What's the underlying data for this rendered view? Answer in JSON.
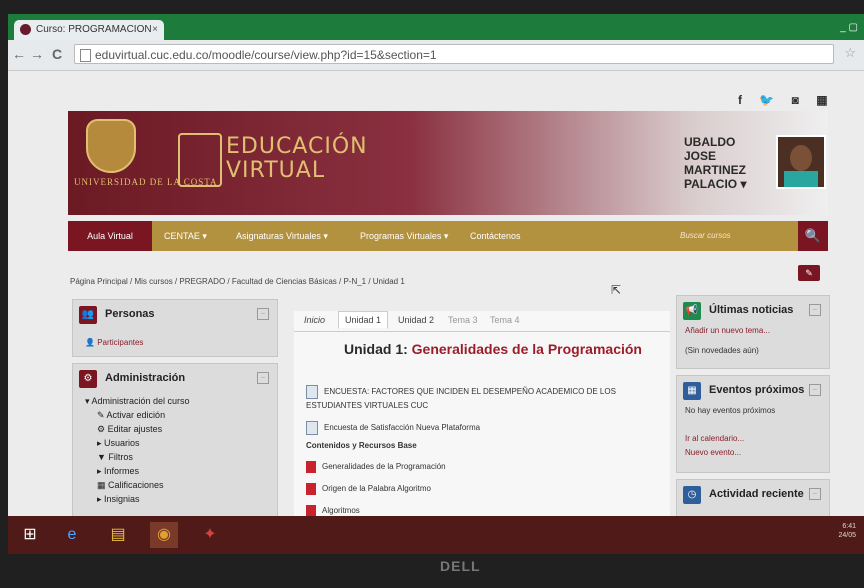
{
  "browser": {
    "tab_title": "Curso: PROGRAMACION",
    "tab_close": "×",
    "back": "←",
    "forward": "→",
    "reload": "C",
    "url": "eduvirtual.cuc.edu.co/moodle/course/view.php?id=15&section=1",
    "window_controls": "_ ▢",
    "star": "☆"
  },
  "header": {
    "social": [
      "f",
      "🐦",
      "◙",
      "▦"
    ],
    "university_name": "UNIVERSIDAD DE LA COSTA",
    "site_title_line1": "EDUCACIÓN",
    "site_title_line2": "VIRTUAL",
    "user_name_line1": "UBALDO JOSE",
    "user_name_line2": "MARTINEZ",
    "user_name_line3": "PALACIO ▾"
  },
  "nav": {
    "items": [
      "Aula Virtual",
      "CENTAE ▾",
      "Asignaturas Virtuales ▾",
      "Programas Virtuales ▾",
      "Contáctenos"
    ],
    "search_placeholder": "Buscar cursos",
    "search_icon": "🔍"
  },
  "breadcrumb": "Página Principal / Mis cursos / PREGRADO / Facultad de Ciencias Básicas / P-N_1 / Unidad 1",
  "left": {
    "personas": {
      "title": "Personas",
      "link": "Participantes"
    },
    "admin": {
      "title": "Administración",
      "items": [
        "▾ Administración del curso",
        "✎ Activar edición",
        "⚙ Editar ajustes",
        "▸ Usuarios",
        "▼ Filtros",
        "▸ Informes",
        "▦ Calificaciones",
        "▸ Insignias"
      ]
    }
  },
  "center": {
    "tabs": [
      "Inicio",
      "Unidad 1",
      "Unidad 2",
      "Tema 3",
      "Tema 4"
    ],
    "unit_prefix": "Unidad 1: ",
    "unit_title": "Generalidades de la Programación",
    "survey1_line1": "ENCUESTA: FACTORES QUE INCIDEN EL DESEMPEÑO ACADEMICO DE LOS",
    "survey1_line2": "ESTUDIANTES VIRTUALES CUC",
    "survey2": "Encuesta de Satisfacción Nueva Plataforma",
    "section": "Contenidos y Recursos Base",
    "resources": [
      "Generalidades de la Programación",
      "Origen de la Palabra Algoritmo",
      "Algoritmos"
    ]
  },
  "right": {
    "news": {
      "title": "Últimas noticias",
      "add": "Añadir un nuevo tema...",
      "empty": "(Sin novedades aún)"
    },
    "events": {
      "title": "Eventos próximos",
      "none": "No hay eventos próximos",
      "calendar": "Ir al calendario...",
      "new": "Nuevo evento..."
    },
    "activity": {
      "title": "Actividad reciente"
    }
  },
  "taskbar": {
    "clock_time": "6:41",
    "clock_date": "24/05"
  },
  "monitor_brand": "DELL"
}
